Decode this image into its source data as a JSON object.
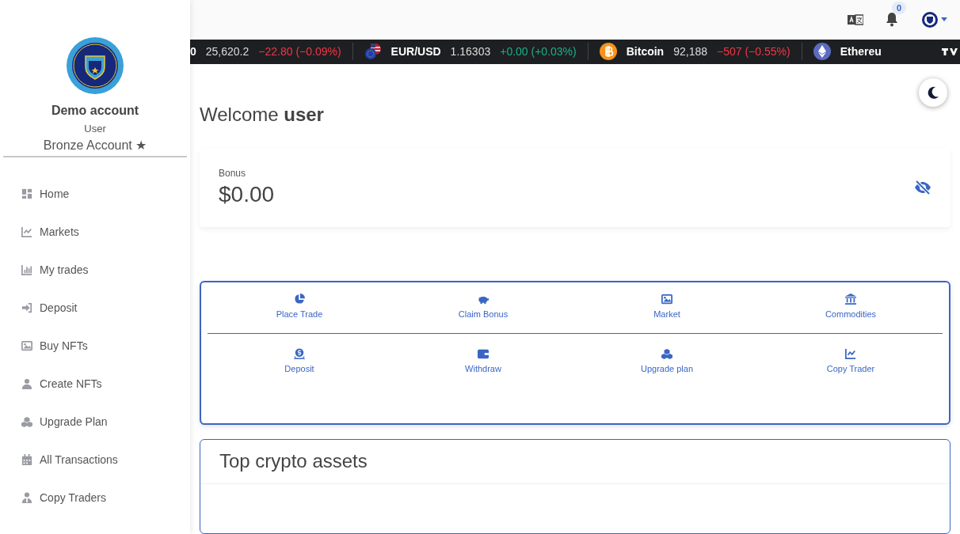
{
  "sidebar": {
    "account_name": "Demo account",
    "role": "User",
    "tier": "Bronze Account ★",
    "items": [
      {
        "label": "Home",
        "kind": "dashboard"
      },
      {
        "label": "Markets",
        "kind": "chart"
      },
      {
        "label": "My trades",
        "kind": "bars"
      },
      {
        "label": "Deposit",
        "kind": "login"
      },
      {
        "label": "Buy NFTs",
        "kind": "image"
      },
      {
        "label": "Create NFTs",
        "kind": "person"
      },
      {
        "label": "Upgrade Plan",
        "kind": "cubes"
      },
      {
        "label": "All Transactions",
        "kind": "calendar"
      },
      {
        "label": "Copy Traders",
        "kind": "trader"
      }
    ]
  },
  "topbar": {
    "notification_count": "0"
  },
  "ticker": [
    {
      "name": "0",
      "price": "25,620.2",
      "change": "−22.80 (−0.09%)",
      "color": "#f23645",
      "kind": "plain"
    },
    {
      "name": "EUR/USD",
      "price": "1.16303",
      "change": "+0.00 (+0.03%)",
      "color": "#1ab089",
      "kind": "flags"
    },
    {
      "name": "Bitcoin",
      "price": "92,188",
      "change": "−507 (−0.55%)",
      "color": "#f23645",
      "kind": "btc"
    },
    {
      "name": "Ethereu",
      "kind": "eth"
    }
  ],
  "welcome": {
    "greeting": "Welcome",
    "user": "user"
  },
  "bonus": {
    "label": "Bonus",
    "amount": "$0.00"
  },
  "actions": [
    [
      {
        "label": "Place Trade",
        "kind": "pie"
      },
      {
        "label": "Claim Bonus",
        "kind": "piggy"
      },
      {
        "label": "Market",
        "kind": "image"
      },
      {
        "label": "Commodities",
        "kind": "bank"
      }
    ],
    [
      {
        "label": "Deposit",
        "kind": "coin"
      },
      {
        "label": "Withdraw",
        "kind": "wallet"
      },
      {
        "label": "Upgrade plan",
        "kind": "cubes"
      },
      {
        "label": "Copy Trader",
        "kind": "chart"
      }
    ]
  ],
  "assets": {
    "title": "Top crypto assets"
  }
}
